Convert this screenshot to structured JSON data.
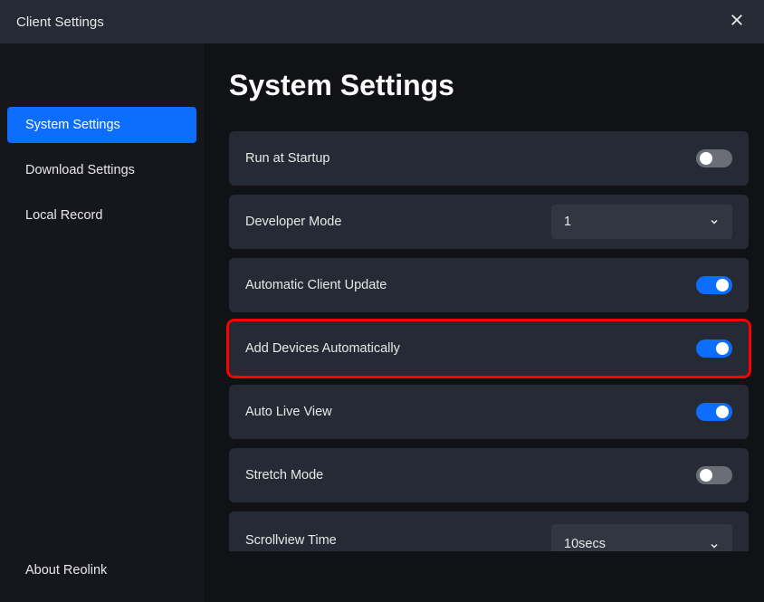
{
  "header": {
    "title": "Client Settings"
  },
  "sidebar": {
    "items": [
      {
        "label": "System Settings",
        "active": true
      },
      {
        "label": "Download Settings",
        "active": false
      },
      {
        "label": "Local Record",
        "active": false
      }
    ],
    "footer": "About Reolink"
  },
  "main": {
    "title": "System Settings",
    "rows": [
      {
        "label": "Run at Startup",
        "type": "toggle",
        "value": false
      },
      {
        "label": "Developer Mode",
        "type": "select",
        "value": "1"
      },
      {
        "label": "Automatic Client Update",
        "type": "toggle",
        "value": true
      },
      {
        "label": "Add Devices Automatically",
        "type": "toggle",
        "value": true,
        "highlighted": true
      },
      {
        "label": "Auto Live View",
        "type": "toggle",
        "value": true
      },
      {
        "label": "Stretch Mode",
        "type": "toggle",
        "value": false
      },
      {
        "label": "Scrollview Time",
        "type": "select",
        "value": "10secs"
      }
    ]
  },
  "colors": {
    "accent": "#0d6efd",
    "highlight": "#ff0000"
  }
}
